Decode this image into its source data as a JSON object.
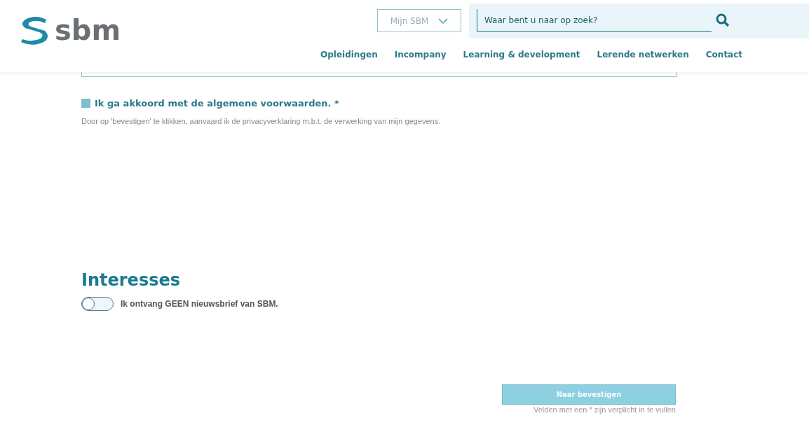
{
  "header": {
    "logo": "sbm",
    "account_menu": {
      "label": "Mijn SBM"
    },
    "search": {
      "placeholder": "Waar bent u naar op zoek?"
    },
    "nav": [
      "Opleidingen",
      "Incompany",
      "Learning & development",
      "Lerende netwerken",
      "Contact"
    ]
  },
  "terms": {
    "label": "Ik ga akkoord met de algemene voorwaarden. *",
    "checked": false,
    "note": "Door op 'bevestigen' te klikken, aanvaard ik de privacyverklaring m.b.t. de verwerking van mijn gegevens."
  },
  "interests": {
    "title": "Interesses",
    "newsletter_opt_out": {
      "label": "Ik ontvang GEEN nieuwsbrief van SBM.",
      "on": false
    }
  },
  "submit": {
    "label": "Naar bevestigen",
    "disabled": true
  },
  "required_note": "Velden met een * zijn verplicht in te vullen"
}
